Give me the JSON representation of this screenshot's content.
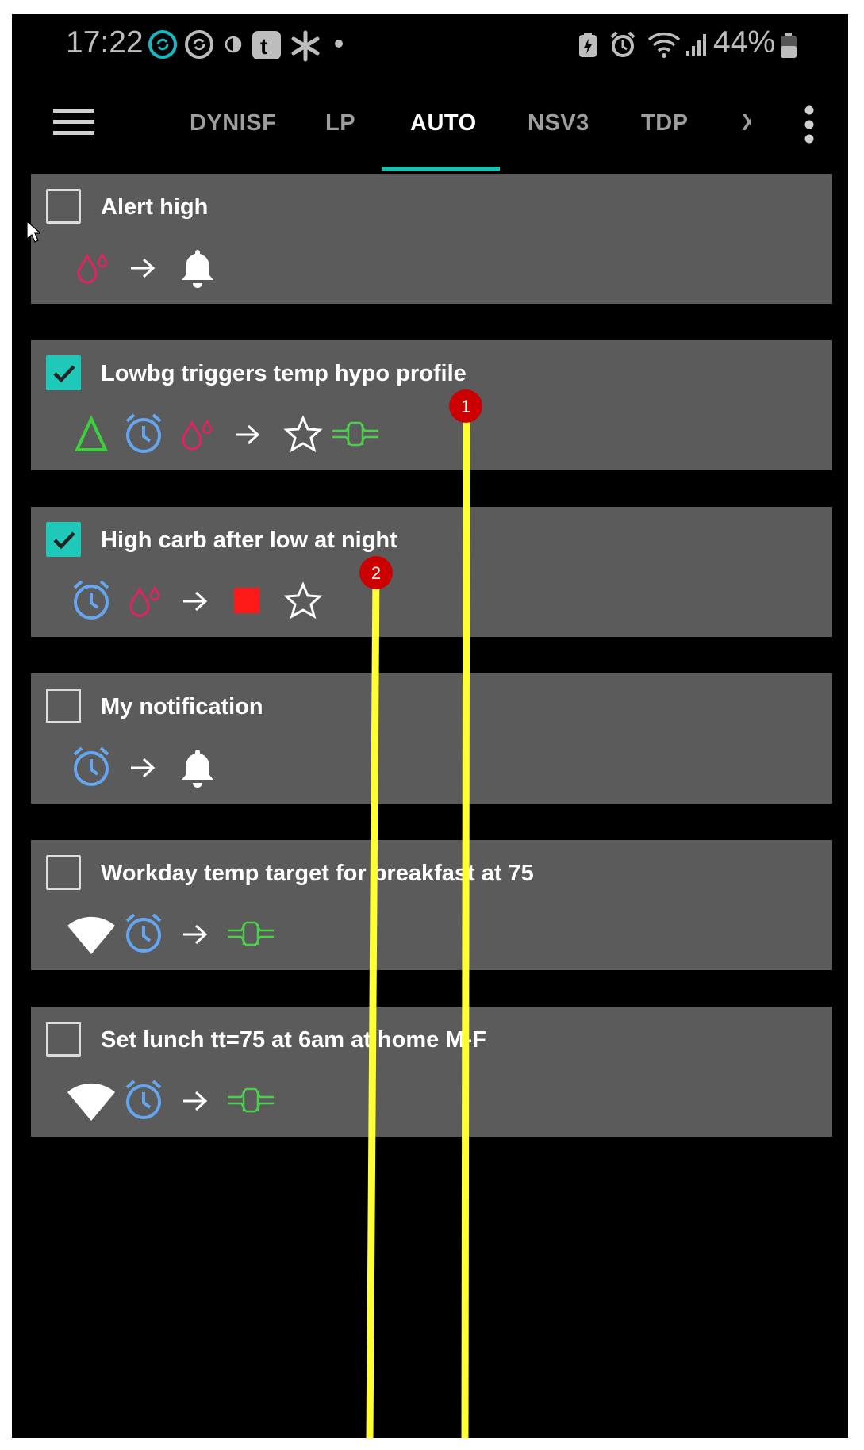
{
  "status_bar": {
    "time": "17:22",
    "battery": "44%",
    "icons": [
      "sync-icon",
      "sync-icon",
      "half-circle-icon",
      "tumblr-icon",
      "asterisk-icon",
      "dot-icon",
      "battery-saver-icon",
      "alarm-icon",
      "wifi-icon",
      "signal-icon",
      "battery-icon"
    ]
  },
  "app_bar": {
    "tabs": [
      {
        "label": "DYNISF",
        "active": false
      },
      {
        "label": "LP",
        "active": false
      },
      {
        "label": "AUTO",
        "active": true
      },
      {
        "label": "NSV3",
        "active": false
      },
      {
        "label": "TDP",
        "active": false
      },
      {
        "label": "X",
        "active": false
      }
    ],
    "accent": "#1fbfb0"
  },
  "automations": [
    {
      "title": "Alert high",
      "enabled": false,
      "triggers": [
        "bg-drops-icon"
      ],
      "actions": [
        "bell-icon"
      ]
    },
    {
      "title": "Lowbg triggers temp hypo profile",
      "enabled": true,
      "triggers": [
        "delta-icon",
        "clock-icon",
        "bg-drops-icon"
      ],
      "actions": [
        "star-icon",
        "temp-target-icon"
      ]
    },
    {
      "title": "High carb after low at night",
      "enabled": true,
      "triggers": [
        "clock-icon",
        "bg-drops-icon"
      ],
      "actions": [
        "stop-icon",
        "star-icon"
      ]
    },
    {
      "title": "My notification",
      "enabled": false,
      "triggers": [
        "clock-icon"
      ],
      "actions": [
        "bell-icon"
      ]
    },
    {
      "title": "Workday temp target for breakfast at 75",
      "enabled": false,
      "triggers": [
        "wifi-icon",
        "clock-icon"
      ],
      "actions": [
        "temp-target-icon"
      ]
    },
    {
      "title": "Set lunch tt=75 at 6am at home M-F",
      "enabled": false,
      "triggers": [
        "wifi-icon",
        "clock-icon"
      ],
      "actions": [
        "temp-target-icon"
      ]
    }
  ],
  "annotations": {
    "markers": [
      "1",
      "2"
    ],
    "line_color": "#ffff33",
    "marker_color": "#cc0000"
  }
}
